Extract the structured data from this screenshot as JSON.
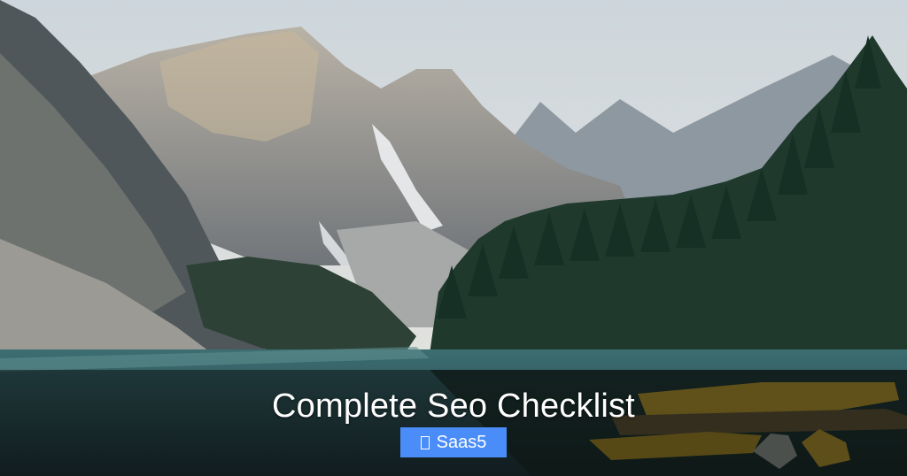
{
  "hero": {
    "title": "Complete Seo Checklist",
    "badge": {
      "label": "Saas5",
      "icon": "folder-icon",
      "color": "#4b8df8"
    }
  },
  "colors": {
    "overlay": "rgba(0,0,0,0.45)",
    "title_text": "#ffffff"
  }
}
